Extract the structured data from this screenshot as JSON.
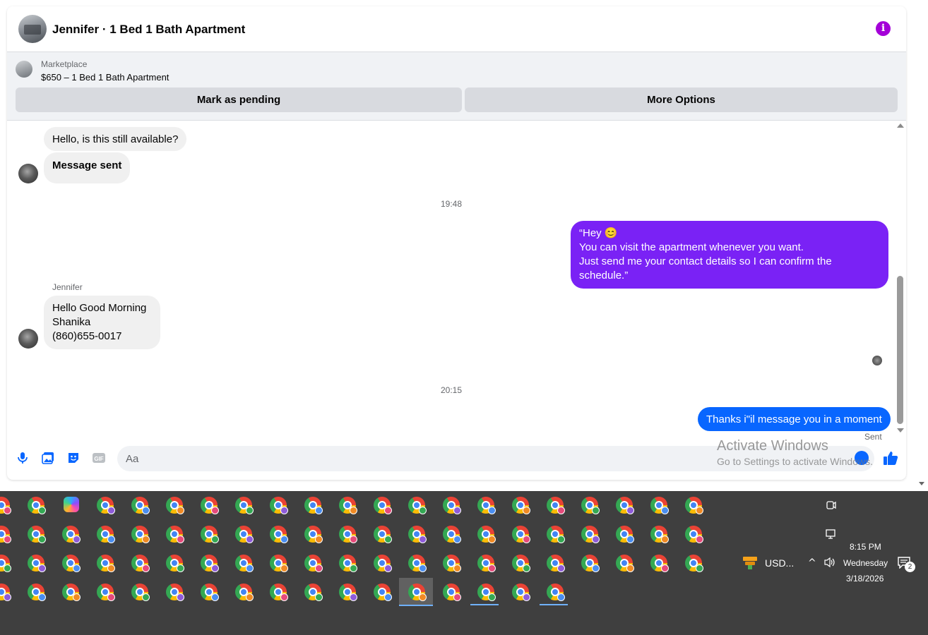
{
  "header": {
    "title": "Jennifer · 1 Bed 1 Bath Apartment",
    "info_icon": "info-icon"
  },
  "listing": {
    "source": "Marketplace",
    "title": "$650 – 1 Bed 1 Bath Apartment",
    "mark_pending_label": "Mark as pending",
    "more_options_label": "More Options"
  },
  "messages": {
    "m1": "Hello, is this still available?",
    "m2": "Message sent",
    "time1": "19:48",
    "m3": "“Hey 😊\nYou can visit the apartment whenever you want.\nJust send me your contact details so I can confirm the schedule.”",
    "sender": "Jennifer",
    "m4": "Hello Good Morning\nShanika\n(860)655-0017",
    "time2": "20:15",
    "m5": "Thanks i\"il message you in a moment",
    "sent_status": "Sent"
  },
  "composer": {
    "placeholder": "Aa"
  },
  "watermark": {
    "title": "Activate Windows",
    "subtitle": "Go to Settings to activate Windows."
  },
  "taskbar": {
    "currency": "USD...",
    "time": "8:15 PM",
    "day": "Wednesday",
    "date": "3/18/2026",
    "notification_count": "2",
    "colors": {
      "accent": "#6fb1ff",
      "background": "#3f3f3f"
    }
  },
  "colors": {
    "outgoing_purple": "#7a22f5",
    "outgoing_blue": "#0866ff",
    "info": "#a400d8"
  }
}
